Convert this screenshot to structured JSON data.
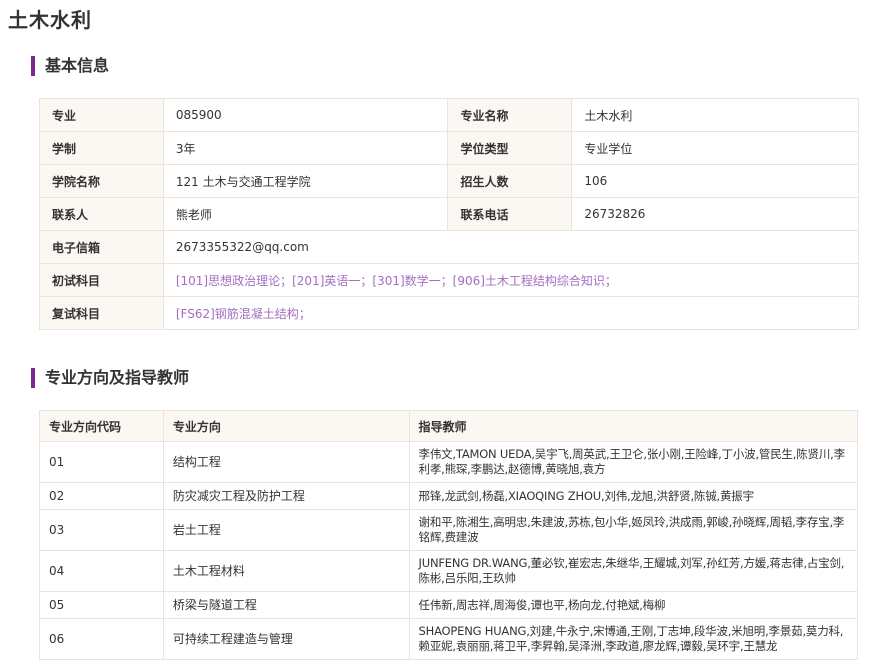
{
  "page_title": "土木水利",
  "sections": {
    "basic_info_title": "基本信息",
    "directions_title": "专业方向及指导教师"
  },
  "basic_info": {
    "major_label": "专业",
    "major_value": "085900",
    "major_name_label": "专业名称",
    "major_name_value": "土木水利",
    "duration_label": "学制",
    "duration_value": "3年",
    "degree_type_label": "学位类型",
    "degree_type_value": "专业学位",
    "college_label": "学院名称",
    "college_value": "121 土木与交通工程学院",
    "enrollment_label": "招生人数",
    "enrollment_value": "106",
    "contact_label": "联系人",
    "contact_value": "熊老师",
    "phone_label": "联系电话",
    "phone_value": "26732826",
    "email_label": "电子信箱",
    "email_value": "2673355322@qq.com",
    "first_exam_label": "初试科目",
    "first_exam_value": "[101]思想政治理论；[201]英语一；[301]数学一；[906]土木工程结构综合知识；",
    "retest_label": "复试科目",
    "retest_value": "[FS62]钢筋混凝土结构；"
  },
  "directions": {
    "headers": [
      "专业方向代码",
      "专业方向",
      "指导教师"
    ],
    "rows": [
      {
        "code": "01",
        "name": "结构工程",
        "teachers": "李伟文,TAMON UEDA,吴宇飞,周英武,王卫仑,张小刚,王险峰,丁小波,管民生,陈贤川,李利孝,熊琛,李鹏达,赵德博,黄晓旭,袁方"
      },
      {
        "code": "02",
        "name": "防灾减灾工程及防护工程",
        "teachers": "邢锋,龙武剑,杨磊,XIAOQING ZHOU,刘伟,龙旭,洪舒贤,陈铖,黄振宇"
      },
      {
        "code": "03",
        "name": "岩土工程",
        "teachers": "谢和平,陈湘生,高明忠,朱建波,苏栋,包小华,姬凤玲,洪成雨,郭峻,孙晓辉,周韬,李存宝,李铭辉,费建波"
      },
      {
        "code": "04",
        "name": "土木工程材料",
        "teachers": "JUNFENG DR.WANG,董必钦,崔宏志,朱继华,王耀城,刘军,孙红芳,方媛,蒋志律,占宝剑,陈彬,吕乐阳,王玖帅"
      },
      {
        "code": "05",
        "name": "桥梁与隧道工程",
        "teachers": "任伟新,周志祥,周海俊,谭也平,杨向龙,付艳斌,梅柳"
      },
      {
        "code": "06",
        "name": "可持续工程建造与管理",
        "teachers": "SHAOPENG HUANG,刘建,牛永宁,宋博通,王刚,丁志坤,段华波,米旭明,李景茹,莫力科,赖亚妮,袁丽丽,蒋卫平,李昇翰,吴泽洲,李政道,廖龙辉,谭毅,吴环宇,王慧龙"
      }
    ]
  }
}
